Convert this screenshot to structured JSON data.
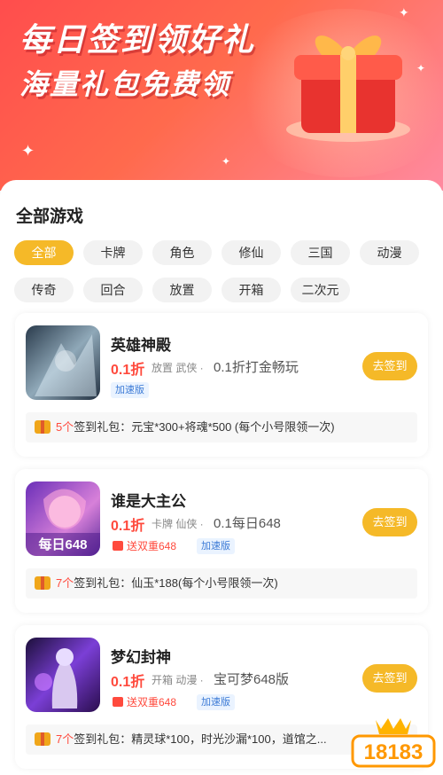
{
  "banner": {
    "title_line1": "每日签到领好礼",
    "title_line2": "海量礼包免费领"
  },
  "section": {
    "title": "全部游戏"
  },
  "filters": {
    "active_index": 0,
    "items": [
      "全部",
      "卡牌",
      "角色",
      "修仙",
      "三国",
      "动漫",
      "传奇",
      "回合",
      "放置",
      "开箱",
      "二次元"
    ]
  },
  "games": [
    {
      "name": "英雄神殿",
      "discount": "0.1折",
      "tags": "放置  武侠 ·",
      "desc": "0.1折打金畅玩",
      "badges": [
        "加速版"
      ],
      "double_badge": "",
      "signin_label": "去签到",
      "gift_count": "5个",
      "gift_text": "签到礼包：元宝*300+将魂*500 (每个小号限领一次)",
      "icon": "hero-temple-icon"
    },
    {
      "name": "谁是大主公",
      "discount": "0.1折",
      "tags": "卡牌  仙侠 ·",
      "desc": "0.1每日648",
      "badges": [
        "加速版"
      ],
      "double_badge": "送双重648",
      "signin_label": "去签到",
      "gift_count": "7个",
      "gift_text": "签到礼包：仙玉*188(每个小号限领一次)",
      "icon_text": "每日648",
      "icon": "lord-game-icon"
    },
    {
      "name": "梦幻封神",
      "discount": "0.1折",
      "tags": "开箱  动漫 ·",
      "desc": "宝可梦648版",
      "badges": [
        "加速版"
      ],
      "double_badge": "送双重648",
      "signin_label": "去签到",
      "gift_count": "7个",
      "gift_text": "签到礼包：精灵球*100，时光沙漏*100，道馆之...",
      "icon": "dream-god-icon"
    }
  ],
  "watermark": "18183",
  "colors": {
    "accent": "#f5b928",
    "discount": "#ff4a3d",
    "banner": "#ff4d4d"
  }
}
